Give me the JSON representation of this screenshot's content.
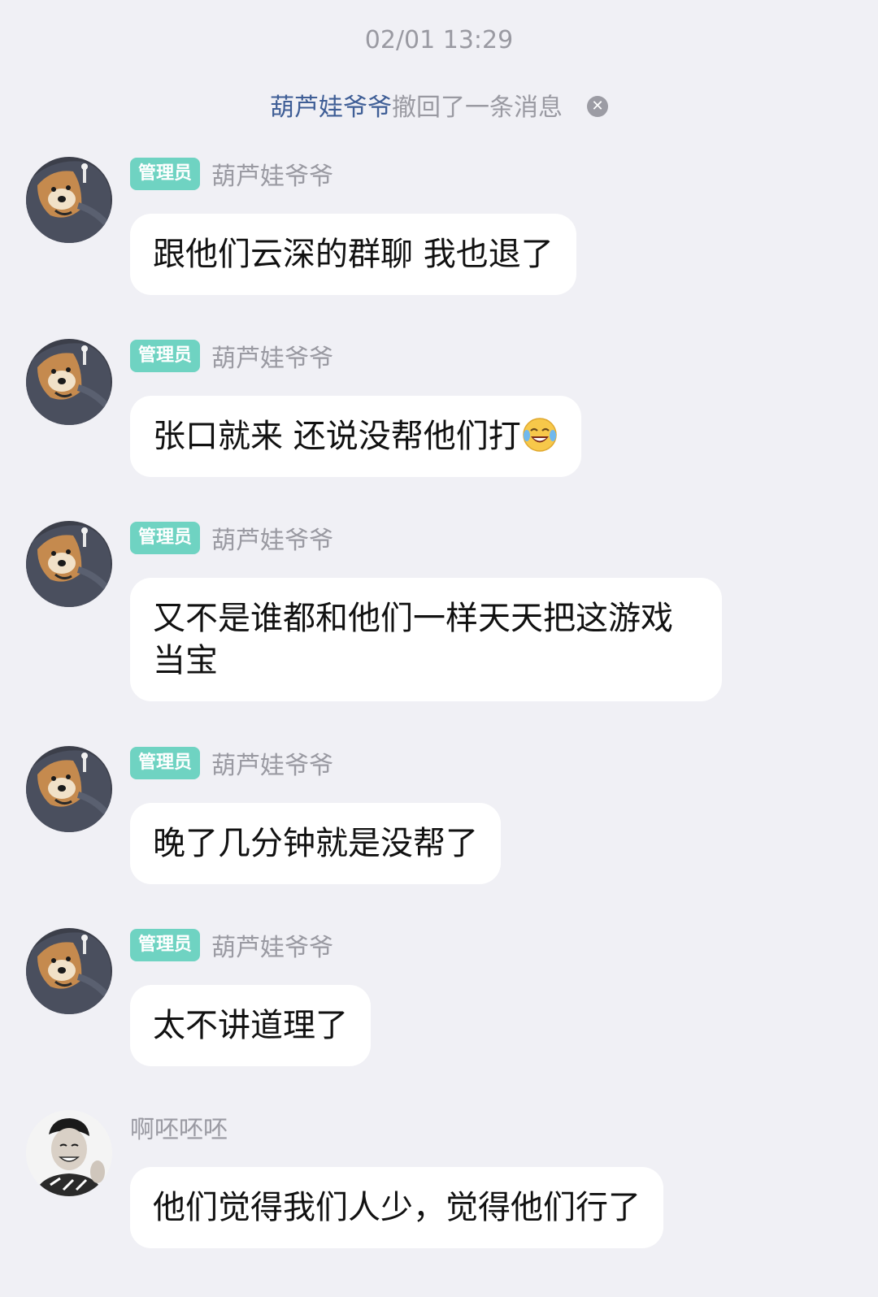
{
  "chat": {
    "timestamp": "02/01 13:29",
    "recall_notice": {
      "name": "葫芦娃爷爷",
      "text": "撤回了一条消息",
      "close_icon": "close-circle-icon"
    },
    "messages": [
      {
        "badge": "管理员",
        "sender": "葫芦娃爷爷",
        "text": "跟他们云深的群聊 我也退了",
        "avatar": "shiba-dog-avatar"
      },
      {
        "badge": "管理员",
        "sender": "葫芦娃爷爷",
        "text": "张口就来 还说没帮他们打",
        "emoji": "tears-of-joy-emoji",
        "avatar": "shiba-dog-avatar"
      },
      {
        "badge": "管理员",
        "sender": "葫芦娃爷爷",
        "text": "又不是谁都和他们一样天天把这游戏当宝",
        "avatar": "shiba-dog-avatar"
      },
      {
        "badge": "管理员",
        "sender": "葫芦娃爷爷",
        "text": "晚了几分钟就是没帮了",
        "avatar": "shiba-dog-avatar"
      },
      {
        "badge": "管理员",
        "sender": "葫芦娃爷爷",
        "text": "太不讲道理了",
        "avatar": "shiba-dog-avatar"
      },
      {
        "sender": "啊呸呸呸",
        "text": "他们觉得我们人少，觉得他们行了",
        "avatar": "smiling-man-avatar"
      }
    ]
  }
}
